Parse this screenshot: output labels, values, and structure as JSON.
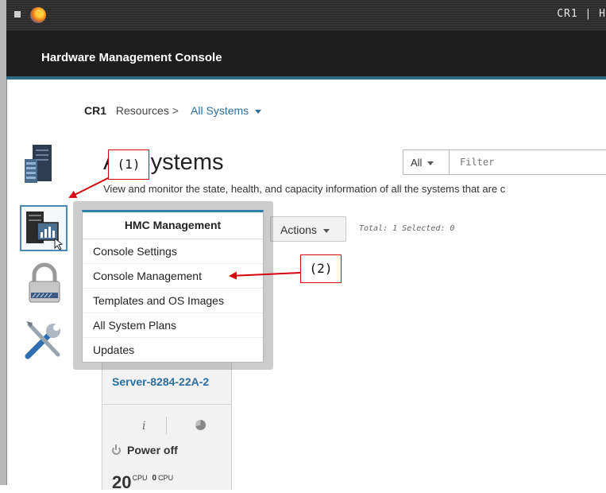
{
  "titlebar": {
    "right_text": "CR1 | H"
  },
  "banner": {
    "title": "Hardware Management Console"
  },
  "breadcrumb": {
    "root": "CR1",
    "resources": "Resources",
    "separator": ">",
    "current": "All Systems"
  },
  "nav": {
    "icons": [
      "server-rack-icon",
      "hmc-management-icon",
      "security-lock-icon",
      "serviceability-tools-icon"
    ]
  },
  "page": {
    "title": "All Systems",
    "description": "View and monitor the state, health, and capacity information of all the systems that are c"
  },
  "filter": {
    "scope": "All",
    "placeholder": "Filter"
  },
  "toolbar": {
    "actions_label": "Actions",
    "summary": "Total: 1 Selected: 0"
  },
  "hmc_menu": {
    "header": "HMC Management",
    "items": [
      "Console Settings",
      "Console Management",
      "Templates and OS Images",
      "All System Plans",
      "Updates"
    ]
  },
  "server_card": {
    "name": "Server-8284-22A-2",
    "info_icon": "i",
    "status": "Power off",
    "cpu_total": "20",
    "cpu_total_label": "CPU",
    "cpu_used": "0",
    "cpu_used_label": "CPU"
  },
  "annotations": {
    "callout_1": "(1)",
    "callout_2": "(2)",
    "color": "#d8000c"
  },
  "colors": {
    "accent": "#2c7fa8",
    "link": "#2a6fa0",
    "banner_bg": "#1e1e1e"
  }
}
